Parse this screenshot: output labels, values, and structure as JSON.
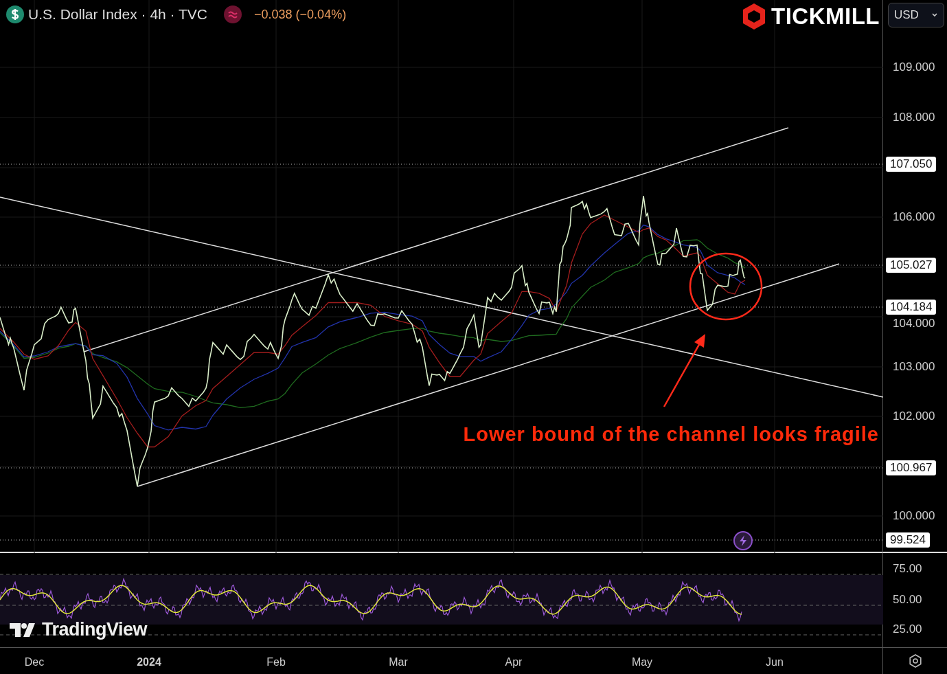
{
  "header": {
    "title": "U.S. Dollar Index · 4h · TVC",
    "change": "−0.038 (−0.04%)"
  },
  "logo": {
    "text": "TICKMILL"
  },
  "currency_select": {
    "value": "USD"
  },
  "price_axis": {
    "ticks": [
      "109.000",
      "108.000",
      "106.000",
      "104.000",
      "103.000",
      "102.000",
      "100.000"
    ],
    "tags": [
      "107.050",
      "105.027",
      "104.184",
      "100.967",
      "99.524"
    ]
  },
  "annotation": {
    "text": "Lower bound of the channel looks fragile"
  },
  "rsi_axis": {
    "ticks": [
      "75.00",
      "50.00",
      "25.00"
    ]
  },
  "watermark": {
    "text": "TradingView"
  },
  "time_axis": {
    "labels": [
      {
        "text": "Dec",
        "kind": "month"
      },
      {
        "text": "2024",
        "kind": "year"
      },
      {
        "text": "Feb",
        "kind": "month"
      },
      {
        "text": "Mar",
        "kind": "month"
      },
      {
        "text": "Apr",
        "kind": "month"
      },
      {
        "text": "May",
        "kind": "month"
      },
      {
        "text": "Jun",
        "kind": "month"
      }
    ]
  }
}
